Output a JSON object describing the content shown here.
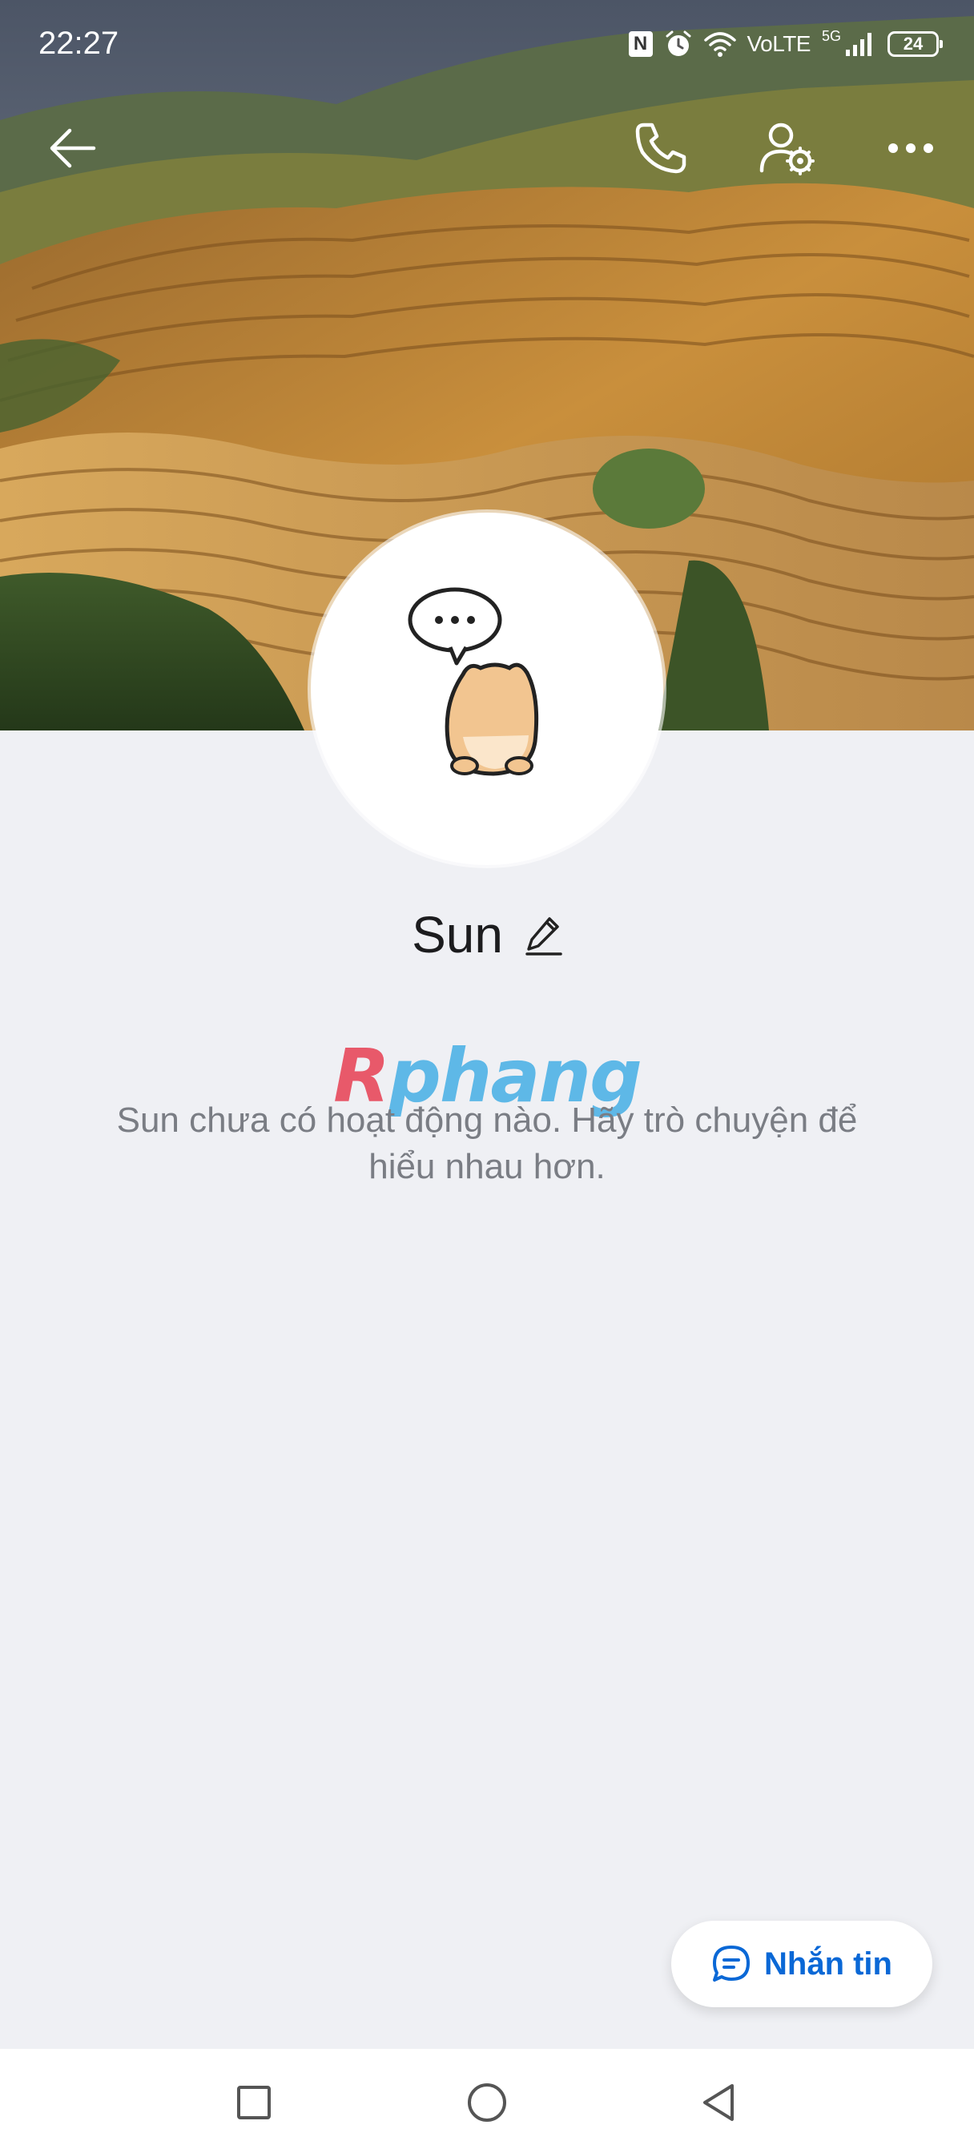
{
  "status_bar": {
    "time": "22:27",
    "network_label": "VoLTE",
    "network_gen": "5G",
    "battery_level": "24",
    "icons": [
      "nfc-icon",
      "alarm-icon",
      "wifi-icon",
      "signal-icon",
      "battery-icon"
    ]
  },
  "header": {
    "icons": [
      "back-arrow-icon",
      "phone-icon",
      "user-settings-icon",
      "more-dots-icon"
    ]
  },
  "profile": {
    "name": "Sun",
    "empty_message": "Sun chưa có hoạt động nào. Hãy trò chuyện để hiểu nhau hơn."
  },
  "watermark": {
    "first": "R",
    "rest": "phang"
  },
  "actions": {
    "message_label": "Nhắn tin"
  },
  "nav": {
    "icons": [
      "recents-square-icon",
      "home-circle-icon",
      "back-triangle-icon"
    ]
  },
  "colors": {
    "accent": "#0a68d6",
    "background": "#eff0f4",
    "text_secondary": "#7a7d84"
  }
}
